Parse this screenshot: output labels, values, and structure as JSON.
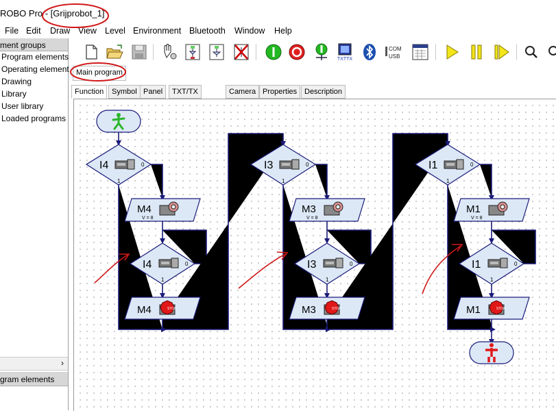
{
  "window": {
    "title": "ROBO Pro - [Grijprobot_1]"
  },
  "menu": [
    "File",
    "Edit",
    "Draw",
    "View",
    "Level",
    "Environment",
    "Bluetooth",
    "Window",
    "Help"
  ],
  "left_panel": {
    "header": "ment groups",
    "items": [
      "Program elements",
      "Operating element",
      "Drawing",
      "Library",
      "User library",
      "Loaded programs"
    ],
    "bottom_header": "gram elements"
  },
  "program_tab": "Main program",
  "tabs": [
    "Function",
    "Symbol",
    "Panel",
    "TXT/TX Display",
    "Camera",
    "Properties",
    "Description"
  ],
  "toolbar": {
    "txt_label": "TXTTX",
    "com_label": "COM",
    "usb_label": "USB"
  },
  "columns": [
    {
      "input": "I4",
      "motor": "M4",
      "speed": "V = 8",
      "branch_zero": "0",
      "branch_one": "1"
    },
    {
      "input": "I3",
      "motor": "M3",
      "speed": "V = 8",
      "branch_zero": "0",
      "branch_one": "1"
    },
    {
      "input": "I1",
      "motor": "M1",
      "speed": "V = 8",
      "branch_zero": "0",
      "branch_one": "1"
    }
  ],
  "stop_label": "STOP",
  "colors": {
    "flow_line": "#1b1b7a",
    "block_fill": "#dce8f6",
    "annotation_red": "#d01818",
    "start_green": "#2bb52b"
  }
}
